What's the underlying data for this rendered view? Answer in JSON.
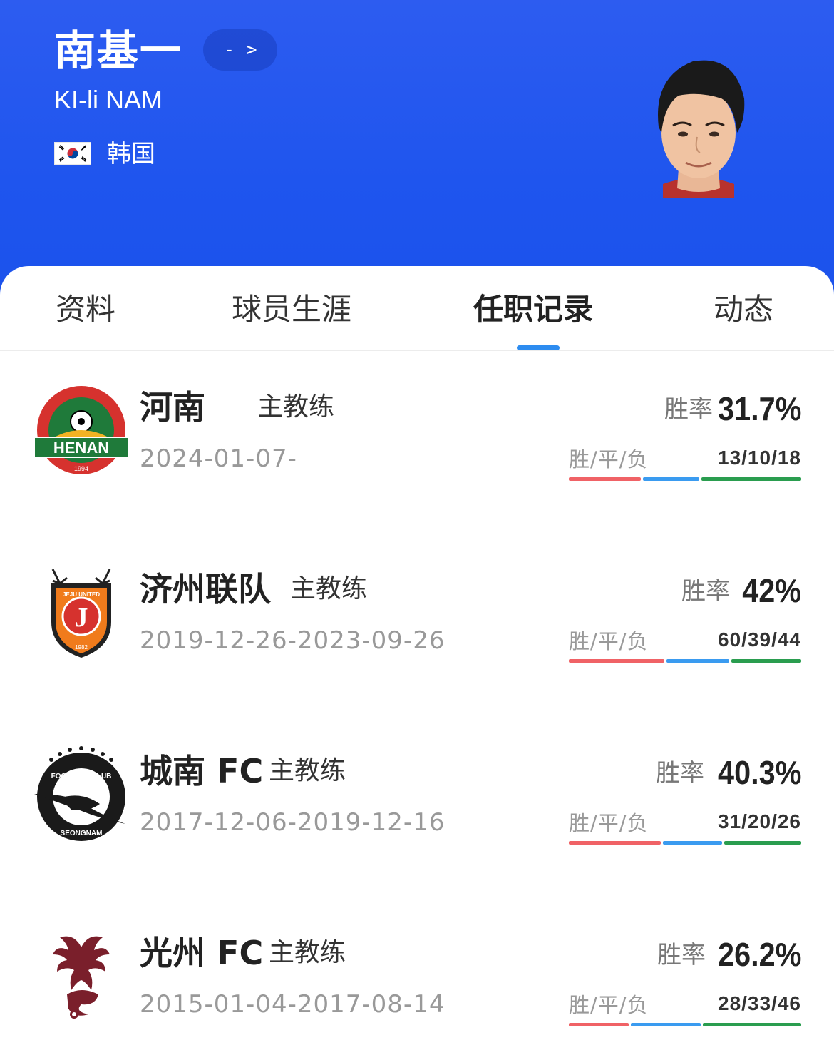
{
  "header": {
    "name": "南基一",
    "more": "- >",
    "name_en": "KI-li NAM",
    "country": "韩国",
    "flag_icon": "south-korea-flag-icon",
    "colors": {
      "background": "#1f55ee"
    }
  },
  "tabs": [
    {
      "label": "资料"
    },
    {
      "label": "球员生涯"
    },
    {
      "label": "任职记录",
      "active": true
    },
    {
      "label": "动态"
    }
  ],
  "records": [
    {
      "team": "河南",
      "role": "主教练",
      "date": "2024-01-07-",
      "win_rate_label": "胜率",
      "win_rate": "31.7%",
      "wdl_label": "胜/平/负",
      "wdl": "13/10/18",
      "w": 13,
      "d": 10,
      "l": 18,
      "logo_icon": "henan-club-logo"
    },
    {
      "team": "济州联队",
      "role": "主教练",
      "date": "2019-12-26-2023-09-26",
      "win_rate_label": "胜率",
      "win_rate": "42%",
      "wdl_label": "胜/平/负",
      "wdl": "60/39/44",
      "w": 60,
      "d": 39,
      "l": 44,
      "logo_icon": "jeju-united-logo"
    },
    {
      "team": "城南 FC",
      "role": "主教练",
      "date": "2017-12-06-2019-12-16",
      "win_rate_label": "胜率",
      "win_rate": "40.3%",
      "wdl_label": "胜/平/负",
      "wdl": "31/20/26",
      "w": 31,
      "d": 20,
      "l": 26,
      "logo_icon": "seongnam-fc-logo"
    },
    {
      "team": "光州 FC",
      "role": "主教练",
      "date": "2015-01-04-2017-08-14",
      "win_rate_label": "胜率",
      "win_rate": "26.2%",
      "wdl_label": "胜/平/负",
      "wdl": "28/33/46",
      "w": 28,
      "d": 33,
      "l": 46,
      "logo_icon": "gwangju-fc-logo"
    }
  ],
  "colors": {
    "win": "#f06266",
    "draw": "#3a9bf0",
    "loss": "#2a9d4f",
    "tab_indicator": "#2d8cf0"
  }
}
